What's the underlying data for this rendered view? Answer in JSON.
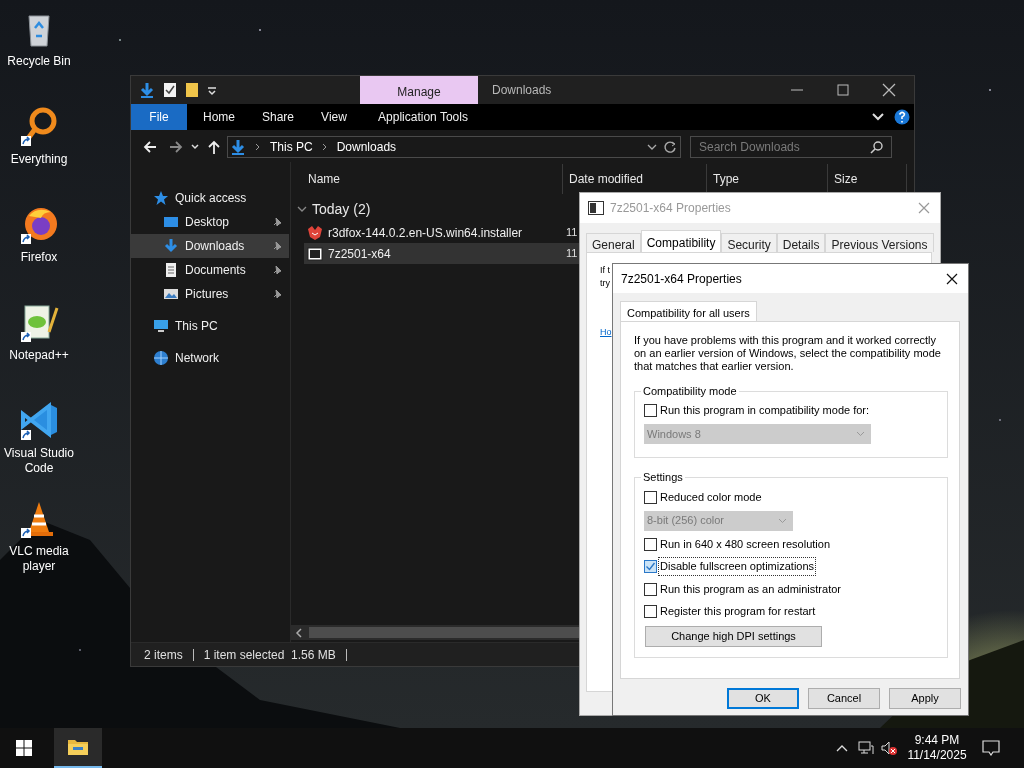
{
  "desktop_icons": [
    {
      "label": "Recycle Bin",
      "kind": "recycle",
      "shortcut": false
    },
    {
      "label": "Everything",
      "kind": "everything",
      "shortcut": true
    },
    {
      "label": "Firefox",
      "kind": "firefox",
      "shortcut": true
    },
    {
      "label": "Notepad++",
      "kind": "notepad",
      "shortcut": true
    },
    {
      "label": "Visual Studio Code",
      "kind": "vscode",
      "shortcut": true
    },
    {
      "label": "VLC media player",
      "kind": "vlc",
      "shortcut": true
    }
  ],
  "explorer": {
    "title": "Downloads",
    "contextual_tab": "Manage",
    "ribbon_tabs": [
      {
        "label": "File",
        "kind": "file"
      },
      {
        "label": "Home",
        "kind": "tab"
      },
      {
        "label": "Share",
        "kind": "tab"
      },
      {
        "label": "View",
        "kind": "tab"
      },
      {
        "label": "Application Tools",
        "kind": "tab"
      }
    ],
    "address": [
      "This PC",
      "Downloads"
    ],
    "search": {
      "placeholder": "Search Downloads"
    },
    "navigation": [
      {
        "label": "Quick access",
        "kind": "star",
        "selected": false,
        "children": [
          {
            "label": "Desktop",
            "kind": "desktop",
            "pinned": true,
            "selected": false
          },
          {
            "label": "Downloads",
            "kind": "download",
            "pinned": true,
            "selected": true
          },
          {
            "label": "Documents",
            "kind": "document",
            "pinned": true,
            "selected": false
          },
          {
            "label": "Pictures",
            "kind": "pictures",
            "pinned": true,
            "selected": false
          }
        ]
      },
      {
        "label": "This PC",
        "kind": "pc",
        "selected": false
      },
      {
        "label": "Network",
        "kind": "network",
        "selected": false
      }
    ],
    "columns": [
      "Name",
      "Date modified",
      "Type",
      "Size"
    ],
    "group": {
      "label": "Today (2)",
      "expanded": true
    },
    "files": [
      {
        "name": "r3dfox-144.0.2.en-US.win64.installer",
        "date": "11",
        "kind": "fox",
        "selected": false
      },
      {
        "name": "7z2501-x64",
        "date": "11",
        "kind": "sevenzip",
        "selected": true
      }
    ],
    "status_bar": [
      "2 items",
      "1 item selected  1.56 MB"
    ]
  },
  "back_dialog": {
    "title": "7z2501-x64 Properties",
    "tabs": [
      {
        "label": "General",
        "selected": false
      },
      {
        "label": "Compatibility",
        "selected": true
      },
      {
        "label": "Security",
        "selected": false
      },
      {
        "label": "Details",
        "selected": false
      },
      {
        "label": "Previous Versions",
        "selected": false
      }
    ],
    "fragments": [
      "If t",
      "try"
    ],
    "link_fragment": "Ho"
  },
  "front_dialog": {
    "title": "7z2501-x64 Properties",
    "tab": "Compatibility for all users",
    "description": "If you have problems with this program and it worked correctly on an earlier version of Windows, select the compatibility mode that matches that earlier version.",
    "compat_mode": {
      "legend": "Compatibility mode",
      "checkbox": {
        "label": "Run this program in compatibility mode for:",
        "checked": false
      },
      "select": {
        "value": "Windows 8",
        "disabled": true
      }
    },
    "settings": {
      "legend": "Settings",
      "items": [
        {
          "kind": "checkbox",
          "label": "Reduced color mode",
          "checked": false
        },
        {
          "kind": "select",
          "value": "8-bit (256) color",
          "disabled": true
        },
        {
          "kind": "checkbox",
          "label": "Run in 640 x 480 screen resolution",
          "checked": false
        },
        {
          "kind": "checkbox",
          "label": "Disable fullscreen optimizations",
          "checked": true
        },
        {
          "kind": "checkbox",
          "label": "Run this program as an administrator",
          "checked": false
        },
        {
          "kind": "checkbox",
          "label": "Register this program for restart",
          "checked": false
        },
        {
          "kind": "button",
          "label": "Change high DPI settings"
        }
      ]
    },
    "buttons": [
      {
        "label": "OK",
        "default": true
      },
      {
        "label": "Cancel",
        "default": false
      },
      {
        "label": "Apply",
        "default": false
      }
    ]
  },
  "taskbar": {
    "time": "9:44 PM",
    "date": "11/14/2025"
  }
}
